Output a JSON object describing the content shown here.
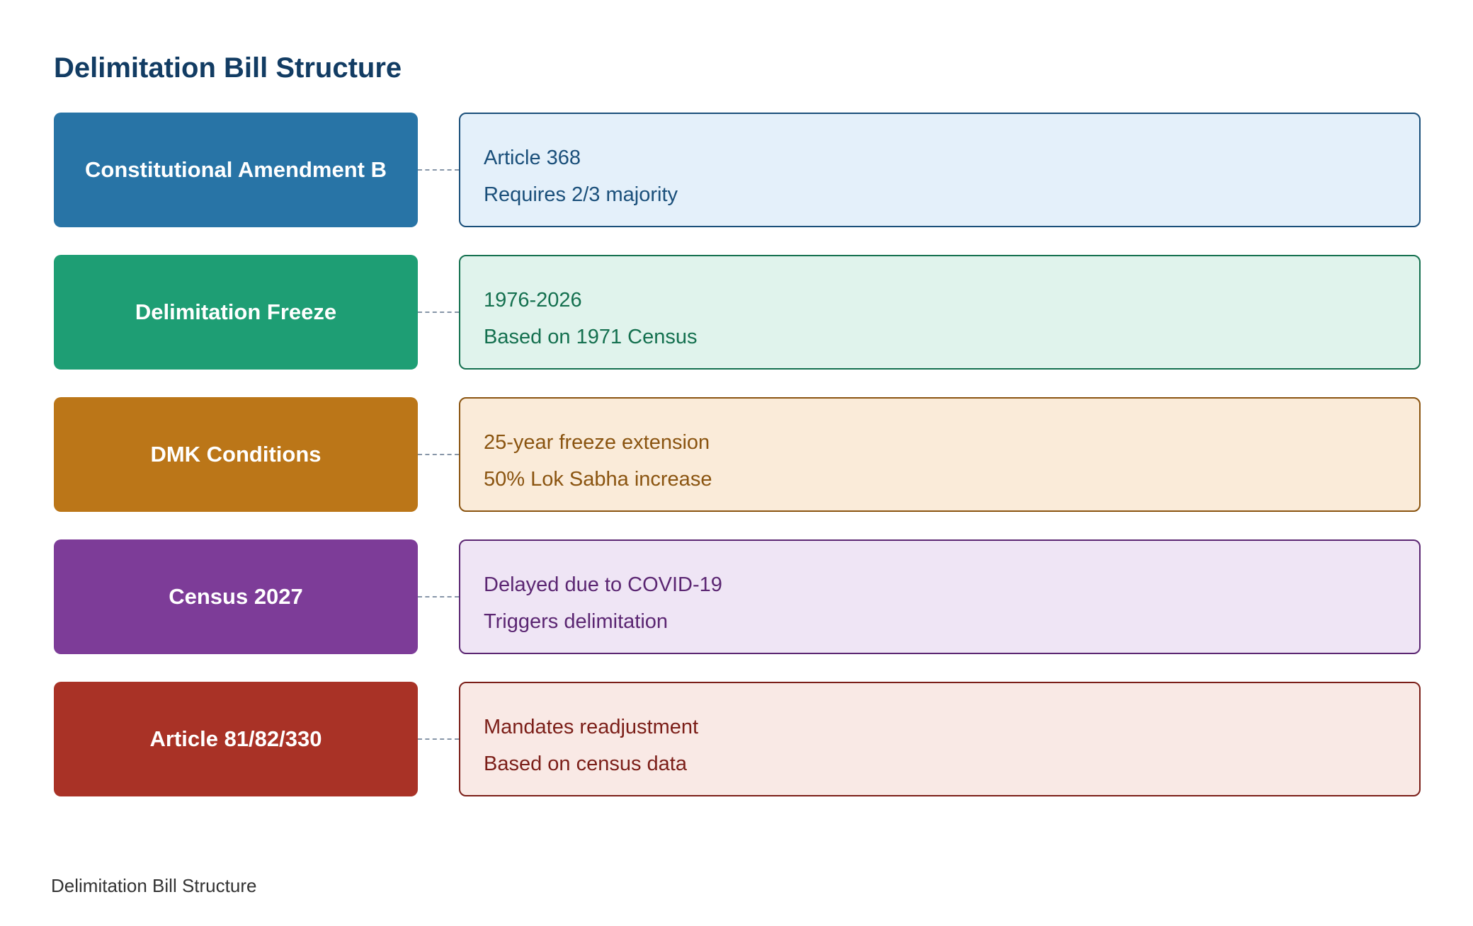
{
  "title": "Delimitation Bill Structure",
  "rows": [
    {
      "label": "Constitutional Amendment B",
      "details": [
        "Article 368",
        "Requires 2/3 majority"
      ],
      "colors": {
        "label_bg": "#2874a6",
        "detail_bg": "#e4f0fa",
        "detail_border": "#1a4f7a",
        "detail_text": "#1a4f7a"
      }
    },
    {
      "label": "Delimitation Freeze",
      "details": [
        "1976-2026",
        "Based on 1971 Census"
      ],
      "colors": {
        "label_bg": "#1e9e74",
        "detail_bg": "#e0f3ec",
        "detail_border": "#14704f",
        "detail_text": "#14704f"
      }
    },
    {
      "label": "DMK Conditions",
      "details": [
        "25-year freeze extension",
        "50% Lok Sabha increase"
      ],
      "colors": {
        "label_bg": "#bb7618",
        "detail_bg": "#faebd9",
        "detail_border": "#8a5410",
        "detail_text": "#8a5410"
      }
    },
    {
      "label": "Census 2027",
      "details": [
        "Delayed due to COVID-19",
        "Triggers delimitation"
      ],
      "colors": {
        "label_bg": "#7d3c98",
        "detail_bg": "#efe5f5",
        "detail_border": "#5b2672",
        "detail_text": "#5b2672"
      }
    },
    {
      "label": "Article 81/82/330",
      "details": [
        "Mandates readjustment",
        "Based on census data"
      ],
      "colors": {
        "label_bg": "#a93226",
        "detail_bg": "#f9e9e5",
        "detail_border": "#7b1e18",
        "detail_text": "#7b1e18"
      }
    }
  ],
  "footer": {
    "caption": "Delimitation Bill Structure"
  }
}
